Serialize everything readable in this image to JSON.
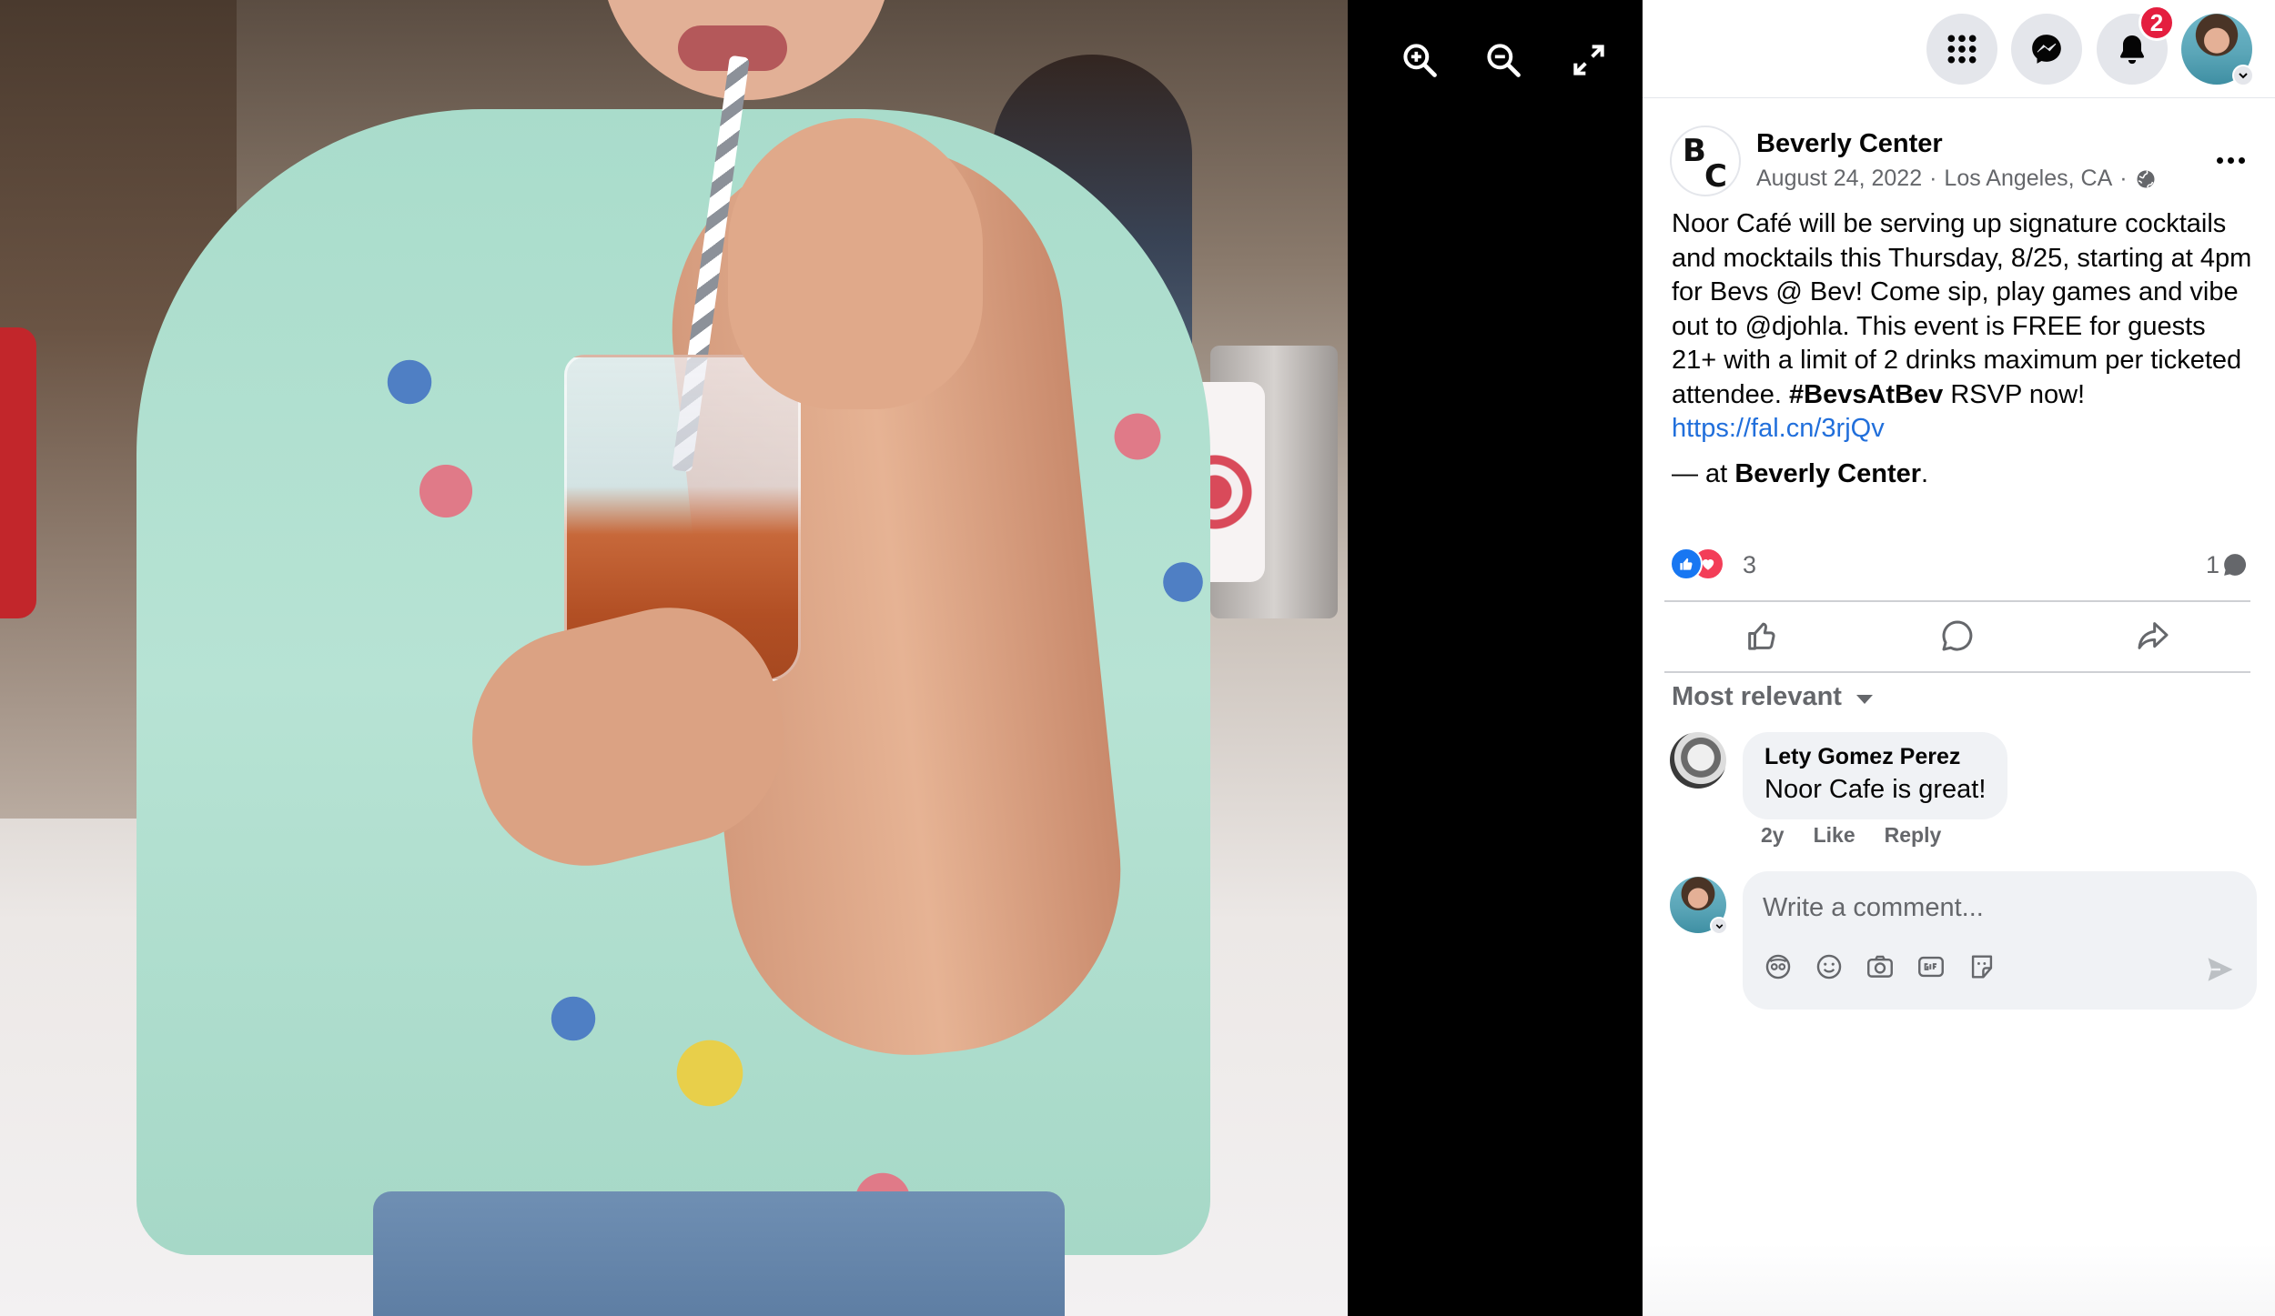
{
  "viewer": {
    "controls": [
      "zoom-in",
      "zoom-out",
      "fullscreen"
    ]
  },
  "topnav": {
    "notifications_badge": "2"
  },
  "post": {
    "page_name": "Beverly Center",
    "logo_letters": [
      "B",
      "C"
    ],
    "date": "August 24, 2022",
    "location": "Los Angeles, CA",
    "meta_separator": "·",
    "audience_icon": "globe-icon",
    "body_text": "Noor Café will be serving up signature cocktails and mocktails this Thursday, 8/25, starting at 4pm for Bevs @ Bev! Come sip, play games and vibe out to @djohla. This event is FREE for guests 21+ with a limit of 2 drinks maximum per ticketed attendee.",
    "hashtag": "#BevsAtBev",
    "cta": "RSVP now!",
    "link": "https://fal.cn/3rjQv",
    "checkin_prefix": "— at",
    "checkin_place": "Beverly Center",
    "checkin_suffix": "."
  },
  "reactions": {
    "count": "3",
    "types": [
      "like",
      "love"
    ],
    "comment_count": "1"
  },
  "actions": [
    "like",
    "comment",
    "share"
  ],
  "comments": {
    "sort_label": "Most relevant",
    "items": [
      {
        "author": "Lety Gomez Perez",
        "text": "Noor Cafe is great!",
        "age": "2y",
        "like_label": "Like",
        "reply_label": "Reply"
      }
    ]
  },
  "composer": {
    "placeholder": "Write a comment..."
  },
  "colors": {
    "link": "#216fdb",
    "like_blue": "#1877f2",
    "love_red": "#f33e58",
    "badge_red": "#e41e3f",
    "secondary_text": "#65676b"
  }
}
